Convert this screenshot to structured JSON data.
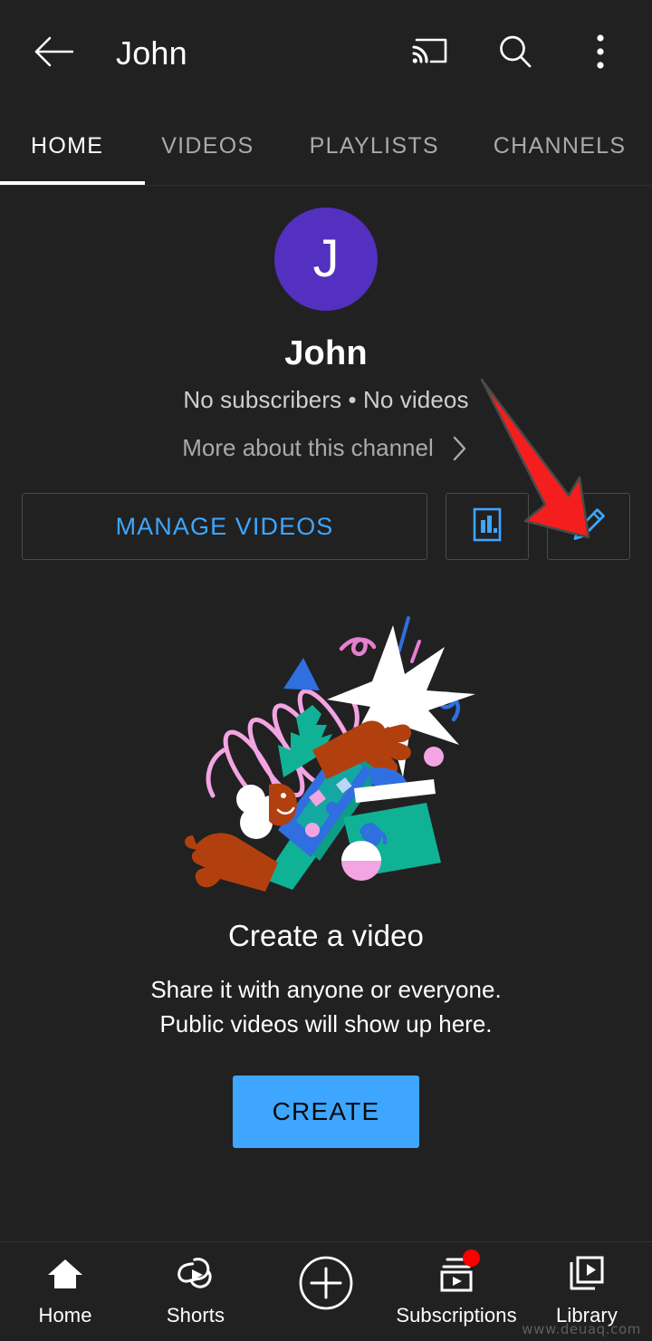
{
  "appbar": {
    "title": "John",
    "back_icon": "arrow-left-icon",
    "cast_icon": "cast-icon",
    "search_icon": "search-icon",
    "overflow_icon": "more-vertical-icon"
  },
  "tabs": {
    "items": [
      {
        "label": "HOME",
        "selected": true
      },
      {
        "label": "VIDEOS",
        "selected": false
      },
      {
        "label": "PLAYLISTS",
        "selected": false
      },
      {
        "label": "CHANNELS",
        "selected": false
      }
    ]
  },
  "channel": {
    "avatar_initial": "J",
    "avatar_color": "#5330bf",
    "name": "John",
    "meta": "No subscribers • No videos",
    "more_label": "More about this channel",
    "more_chevron_icon": "chevron-right-icon"
  },
  "actions": {
    "manage_label": "MANAGE VIDEOS",
    "analytics_icon": "analytics-bar-chart-icon",
    "edit_icon": "pencil-edit-icon",
    "accent_color": "#3ea6ff"
  },
  "empty_state": {
    "illustration_icon": "create-a-video-illustration",
    "title": "Create a video",
    "subtitle_line1": "Share it with anyone or everyone.",
    "subtitle_line2": "Public videos will show up here.",
    "create_label": "CREATE"
  },
  "bottom_nav": {
    "items": [
      {
        "label": "Home",
        "icon": "home-icon",
        "selected": true,
        "badge": false
      },
      {
        "label": "Shorts",
        "icon": "shorts-icon",
        "selected": false,
        "badge": false
      },
      {
        "label": "",
        "icon": "plus-circle-icon",
        "selected": false,
        "badge": false
      },
      {
        "label": "Subscriptions",
        "icon": "subscriptions-icon",
        "selected": false,
        "badge": true
      },
      {
        "label": "Library",
        "icon": "library-icon",
        "selected": false,
        "badge": false
      }
    ],
    "badge_color": "#ff0000"
  },
  "annotation": {
    "arrow_icon": "red-arrow-pointer",
    "arrow_color": "#f51e1e"
  },
  "watermark": {
    "text": "www.deuaq.com"
  }
}
